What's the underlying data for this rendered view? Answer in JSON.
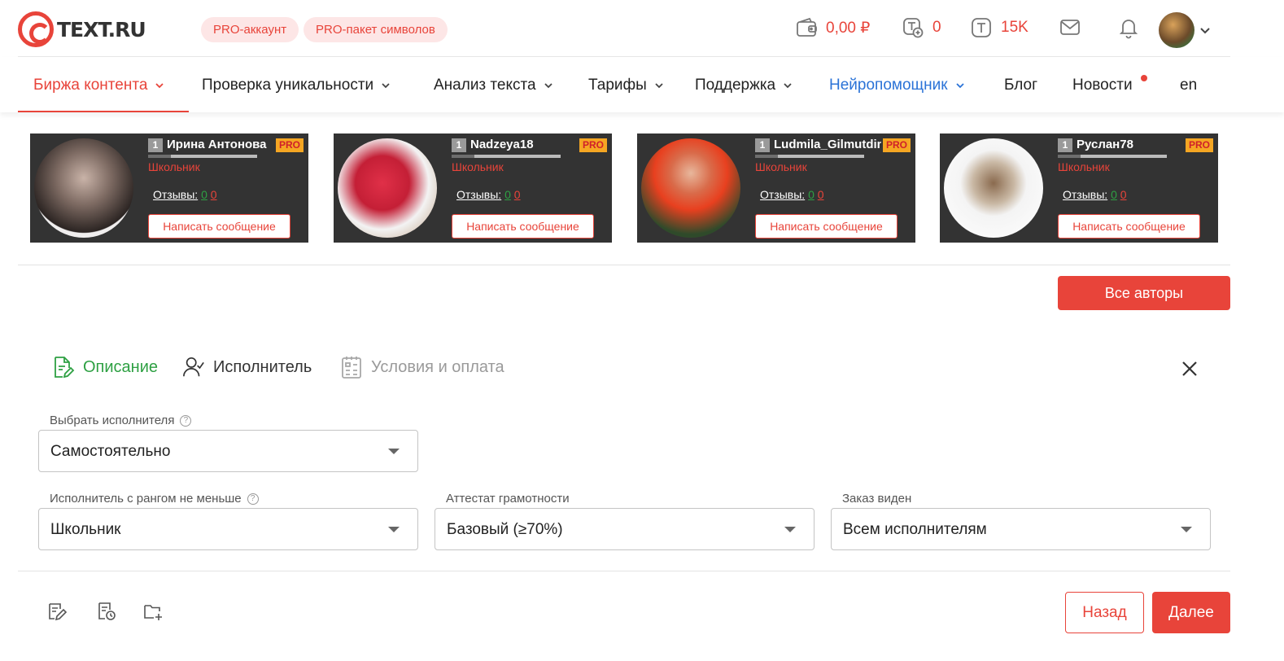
{
  "header": {
    "logo_text": "TEXT.RU",
    "pro_account": "PRO-аккаунт",
    "pro_package": "PRO-пакет символов",
    "balance": "0,00 ₽",
    "tokens_plus": "0",
    "symbols": "15K",
    "icons": {
      "wallet": "wallet-icon",
      "tokens": "token-plus-icon",
      "symbols": "symbol-t-icon",
      "mail": "mail-icon",
      "bell": "bell-icon",
      "chevron": "chevron-down-icon"
    }
  },
  "nav": {
    "items": [
      {
        "label": "Биржа контента"
      },
      {
        "label": "Проверка уникальности"
      },
      {
        "label": "Анализ текста"
      },
      {
        "label": "Тарифы"
      },
      {
        "label": "Поддержка"
      },
      {
        "label": "Нейропомощник"
      },
      {
        "label": "Блог"
      },
      {
        "label": "Новости"
      },
      {
        "label": "en"
      }
    ]
  },
  "authors": {
    "items": [
      {
        "rank": "1",
        "name": "Ирина Антонова",
        "pro": "PRO",
        "rank_name": "Школьник",
        "reviews_label": "Отзывы:",
        "pos": "0",
        "neg": "0",
        "button": "Написать сообщение"
      },
      {
        "rank": "1",
        "name": "Nadzeya18",
        "pro": "PRO",
        "rank_name": "Школьник",
        "reviews_label": "Отзывы:",
        "pos": "0",
        "neg": "0",
        "button": "Написать сообщение"
      },
      {
        "rank": "1",
        "name": "Ludmila_Gilmutdinova",
        "pro": "PRO",
        "rank_name": "Школьник",
        "reviews_label": "Отзывы:",
        "pos": "0",
        "neg": "0",
        "button": "Написать сообщение"
      },
      {
        "rank": "1",
        "name": "Руслан78",
        "pro": "PRO",
        "rank_name": "Школьник",
        "reviews_label": "Отзывы:",
        "pos": "0",
        "neg": "0",
        "button": "Написать сообщение"
      }
    ],
    "all_authors_button": "Все авторы"
  },
  "steps": {
    "items": [
      {
        "label": "Описание",
        "state": "done",
        "color": "#2ea043"
      },
      {
        "label": "Исполнитель",
        "state": "current",
        "color": "#333333"
      },
      {
        "label": "Условия и оплата",
        "state": "pending",
        "color": "#9a9a9a"
      }
    ]
  },
  "form": {
    "executor_label": "Выбрать исполнителя",
    "executor_value": "Самостоятельно",
    "rank_label": "Исполнитель с рангом не меньше",
    "rank_value": "Школьник",
    "attest_label": "Аттестат грамотности",
    "attest_value": "Базовый (≥70%)",
    "visible_label": "Заказ виден",
    "visible_value": "Всем исполнителям"
  },
  "footer": {
    "back_button": "Назад",
    "next_button": "Далее",
    "icons": [
      "edit-document-icon",
      "schedule-document-icon",
      "add-folder-icon"
    ]
  },
  "colors": {
    "accent": "#e8443a",
    "link_blue": "#2b73d7",
    "success": "#2ea043",
    "card_bg": "#333333",
    "pro_badge": "#f5a623"
  }
}
